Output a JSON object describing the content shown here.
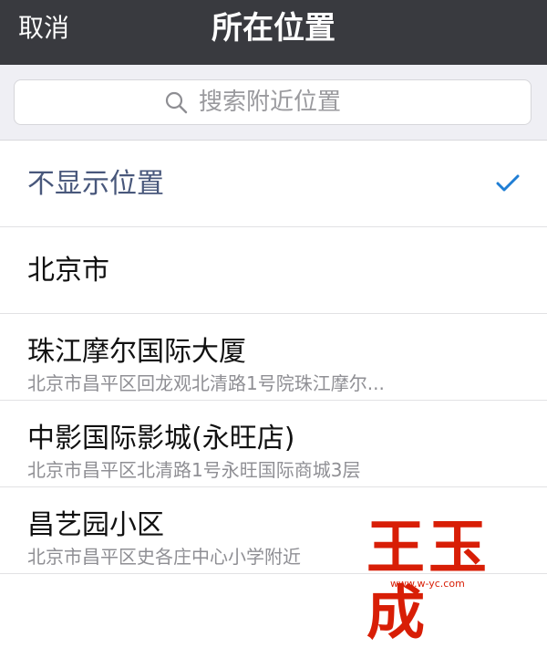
{
  "nav": {
    "cancel_label": "取消",
    "title": "所在位置"
  },
  "search": {
    "placeholder": "搜索附近位置",
    "icon": "search-icon"
  },
  "locations": [
    {
      "title": "不显示位置",
      "selected": true
    },
    {
      "title": "北京市"
    },
    {
      "title": "珠江摩尔国际大厦",
      "address": "北京市昌平区回龙观北清路1号院珠江摩尔..."
    },
    {
      "title": "中影国际影城(永旺店)",
      "address": "北京市昌平区北清路1号永旺国际商城3层"
    },
    {
      "title": "昌艺园小区",
      "address": "北京市昌平区史各庄中心小学附近"
    }
  ],
  "watermark": {
    "text": "王玉成",
    "url": "www.w-yc.com"
  },
  "colors": {
    "navbar": "#393a3f",
    "selected_text": "#48577b",
    "check": "#1f7ed4",
    "watermark": "#d81e06"
  }
}
